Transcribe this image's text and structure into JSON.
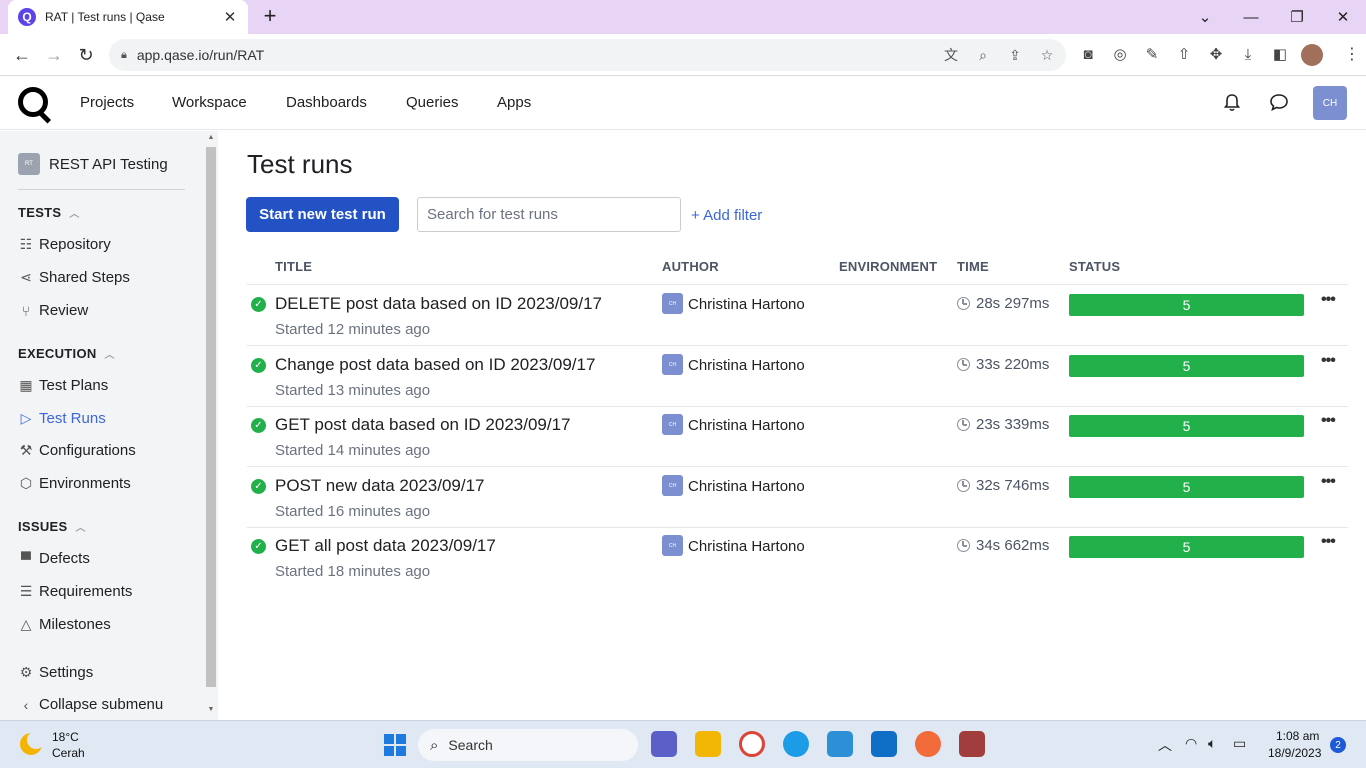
{
  "browser": {
    "tab_title": "RAT | Test runs | Qase",
    "tab_favicon": "Q",
    "tab_close": "✕",
    "new_tab": "+",
    "url": "app.qase.io/run/RAT",
    "minimize": "—",
    "maximize": "❐",
    "close": "✕",
    "collapse": "⌄"
  },
  "app": {
    "nav": [
      "Projects",
      "Workspace",
      "Dashboards",
      "Queries",
      "Apps"
    ],
    "user_initials": "CH"
  },
  "sidebar": {
    "project_initials": "RT",
    "project_name": "REST API Testing",
    "sections": [
      {
        "title": "TESTS",
        "items": [
          {
            "label": "Repository",
            "icon": "repository-icon"
          },
          {
            "label": "Shared Steps",
            "icon": "shared-steps-icon"
          },
          {
            "label": "Review",
            "icon": "review-icon"
          }
        ]
      },
      {
        "title": "EXECUTION",
        "items": [
          {
            "label": "Test Plans",
            "icon": "test-plans-icon"
          },
          {
            "label": "Test Runs",
            "icon": "play-icon",
            "active": true
          },
          {
            "label": "Configurations",
            "icon": "wrench-icon"
          },
          {
            "label": "Environments",
            "icon": "cube-icon"
          }
        ]
      },
      {
        "title": "ISSUES",
        "items": [
          {
            "label": "Defects",
            "icon": "defects-icon"
          },
          {
            "label": "Requirements",
            "icon": "requirements-icon"
          },
          {
            "label": "Milestones",
            "icon": "milestones-icon"
          }
        ]
      }
    ],
    "settings": "Settings",
    "collapse": "Collapse submenu"
  },
  "main": {
    "page_title": "Test runs",
    "start_button": "Start new test run",
    "search_placeholder": "Search for test runs",
    "add_filter": "+ Add filter",
    "columns": [
      "TITLE",
      "AUTHOR",
      "ENVIRONMENT",
      "TIME",
      "STATUS"
    ],
    "runs": [
      {
        "title": "DELETE post data based on ID 2023/09/17",
        "started": "Started 12 minutes ago",
        "author_initials": "CH",
        "author": "Christina Hartono",
        "time": "28s 297ms",
        "status_count": "5",
        "status_color": "#22b04b"
      },
      {
        "title": "Change post data based on ID 2023/09/17",
        "started": "Started 13 minutes ago",
        "author_initials": "CH",
        "author": "Christina Hartono",
        "time": "33s 220ms",
        "status_count": "5",
        "status_color": "#22b04b"
      },
      {
        "title": "GET post data based on ID 2023/09/17",
        "started": "Started 14 minutes ago",
        "author_initials": "CH",
        "author": "Christina Hartono",
        "time": "23s 339ms",
        "status_count": "5",
        "status_color": "#22b04b"
      },
      {
        "title": "POST new data 2023/09/17",
        "started": "Started 16 minutes ago",
        "author_initials": "CH",
        "author": "Christina Hartono",
        "time": "32s 746ms",
        "status_count": "5",
        "status_color": "#22b04b"
      },
      {
        "title": "GET all post data 2023/09/17",
        "started": "Started 18 minutes ago",
        "author_initials": "CH",
        "author": "Christina Hartono",
        "time": "34s 662ms",
        "status_count": "5",
        "status_color": "#22b04b"
      }
    ]
  },
  "taskbar": {
    "temperature": "18°C",
    "condition": "Cerah",
    "search": "Search",
    "time": "1:08 am",
    "date": "18/9/2023",
    "notifications": "2"
  },
  "colors": {
    "accent": "#2252c4",
    "link": "#3b67d9",
    "success": "#22b04b"
  }
}
